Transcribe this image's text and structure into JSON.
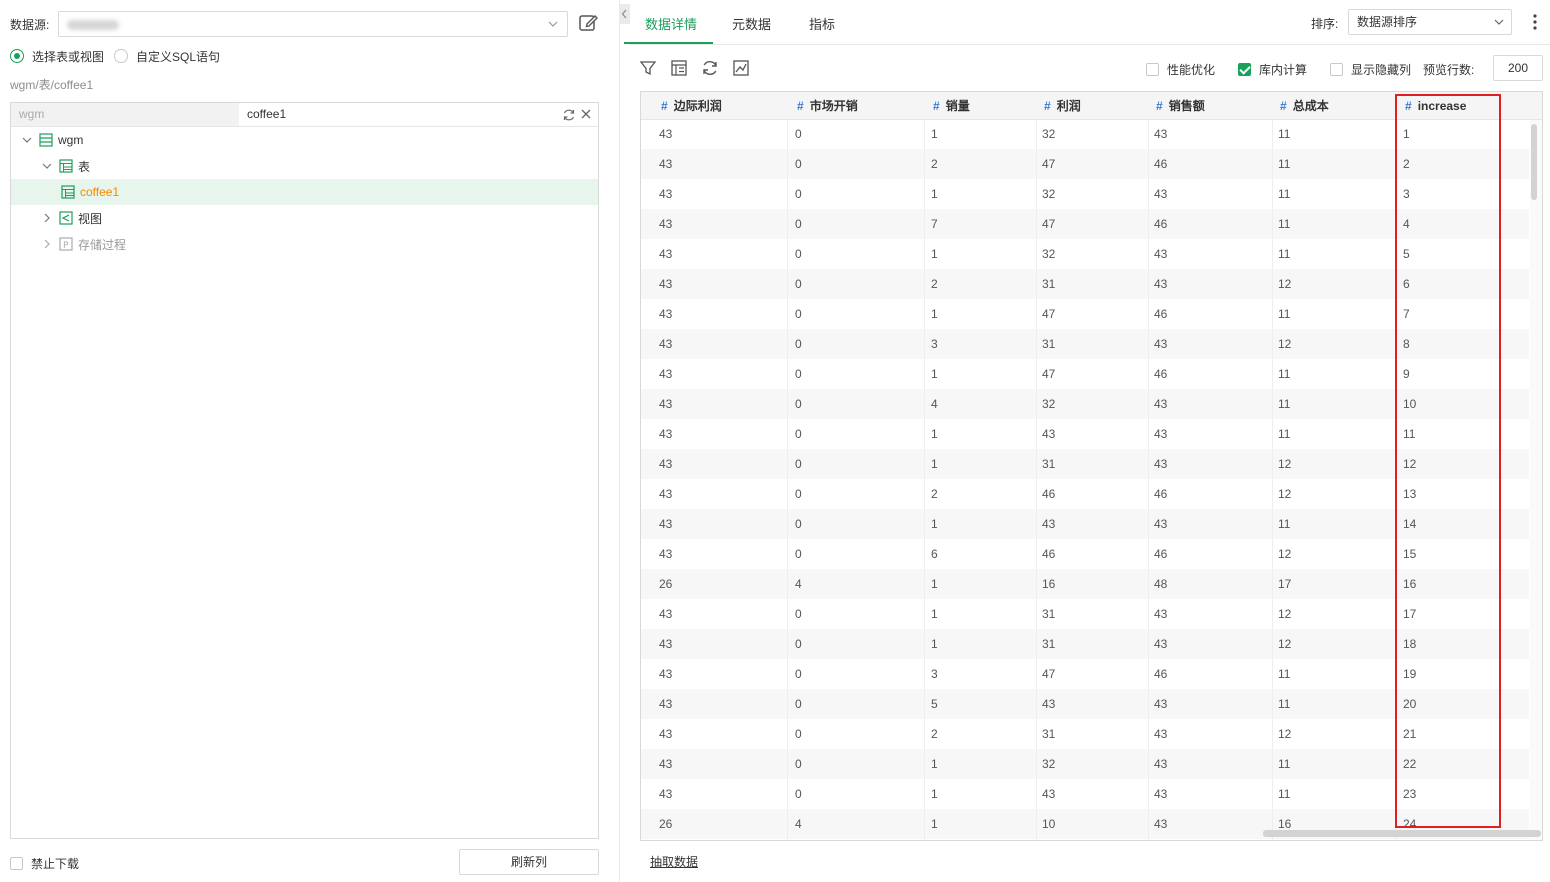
{
  "left": {
    "datasource_label": "数据源:",
    "mode_options": [
      "选择表或视图",
      "自定义SQL语句"
    ],
    "breadcrumb": "wgm/表/coffee1",
    "tree_header": {
      "db": "wgm",
      "table": "coffee1"
    },
    "tree": [
      {
        "label": "wgm"
      },
      {
        "label": "表"
      },
      {
        "label": "coffee1"
      },
      {
        "label": "视图"
      },
      {
        "label": "存储过程"
      }
    ],
    "ban_download": "禁止下载",
    "refresh_columns": "刷新列"
  },
  "tabs": [
    "数据详情",
    "元数据",
    "指标"
  ],
  "sort": {
    "label": "排序:",
    "value": "数据源排序"
  },
  "options": {
    "perf": "性能优化",
    "in_db": "库内计算",
    "show_hidden": "显示隐藏列",
    "preview_rows_label": "预览行数:",
    "preview_rows": "200"
  },
  "colors": {
    "accent": "#1aa05b",
    "hash": "#3a7bd5",
    "highlight": "#e02020"
  },
  "table": {
    "columns": [
      "边际利润",
      "市场开销",
      "销量",
      "利润",
      "销售额",
      "总成本",
      "increase"
    ],
    "rows": [
      [
        "43",
        "0",
        "1",
        "32",
        "43",
        "11",
        "1"
      ],
      [
        "43",
        "0",
        "2",
        "47",
        "46",
        "11",
        "2"
      ],
      [
        "43",
        "0",
        "1",
        "32",
        "43",
        "11",
        "3"
      ],
      [
        "43",
        "0",
        "7",
        "47",
        "46",
        "11",
        "4"
      ],
      [
        "43",
        "0",
        "1",
        "32",
        "43",
        "11",
        "5"
      ],
      [
        "43",
        "0",
        "2",
        "31",
        "43",
        "12",
        "6"
      ],
      [
        "43",
        "0",
        "1",
        "47",
        "46",
        "11",
        "7"
      ],
      [
        "43",
        "0",
        "3",
        "31",
        "43",
        "12",
        "8"
      ],
      [
        "43",
        "0",
        "1",
        "47",
        "46",
        "11",
        "9"
      ],
      [
        "43",
        "0",
        "4",
        "32",
        "43",
        "11",
        "10"
      ],
      [
        "43",
        "0",
        "1",
        "43",
        "43",
        "11",
        "11"
      ],
      [
        "43",
        "0",
        "1",
        "31",
        "43",
        "12",
        "12"
      ],
      [
        "43",
        "0",
        "2",
        "46",
        "46",
        "12",
        "13"
      ],
      [
        "43",
        "0",
        "1",
        "43",
        "43",
        "11",
        "14"
      ],
      [
        "43",
        "0",
        "6",
        "46",
        "46",
        "12",
        "15"
      ],
      [
        "26",
        "4",
        "1",
        "16",
        "48",
        "17",
        "16"
      ],
      [
        "43",
        "0",
        "1",
        "31",
        "43",
        "12",
        "17"
      ],
      [
        "43",
        "0",
        "1",
        "31",
        "43",
        "12",
        "18"
      ],
      [
        "43",
        "0",
        "3",
        "47",
        "46",
        "11",
        "19"
      ],
      [
        "43",
        "0",
        "5",
        "43",
        "43",
        "11",
        "20"
      ],
      [
        "43",
        "0",
        "2",
        "31",
        "43",
        "12",
        "21"
      ],
      [
        "43",
        "0",
        "1",
        "32",
        "43",
        "11",
        "22"
      ],
      [
        "43",
        "0",
        "1",
        "43",
        "43",
        "11",
        "23"
      ],
      [
        "26",
        "4",
        "1",
        "10",
        "43",
        "16",
        "24"
      ]
    ]
  },
  "extract_data": "抽取数据"
}
